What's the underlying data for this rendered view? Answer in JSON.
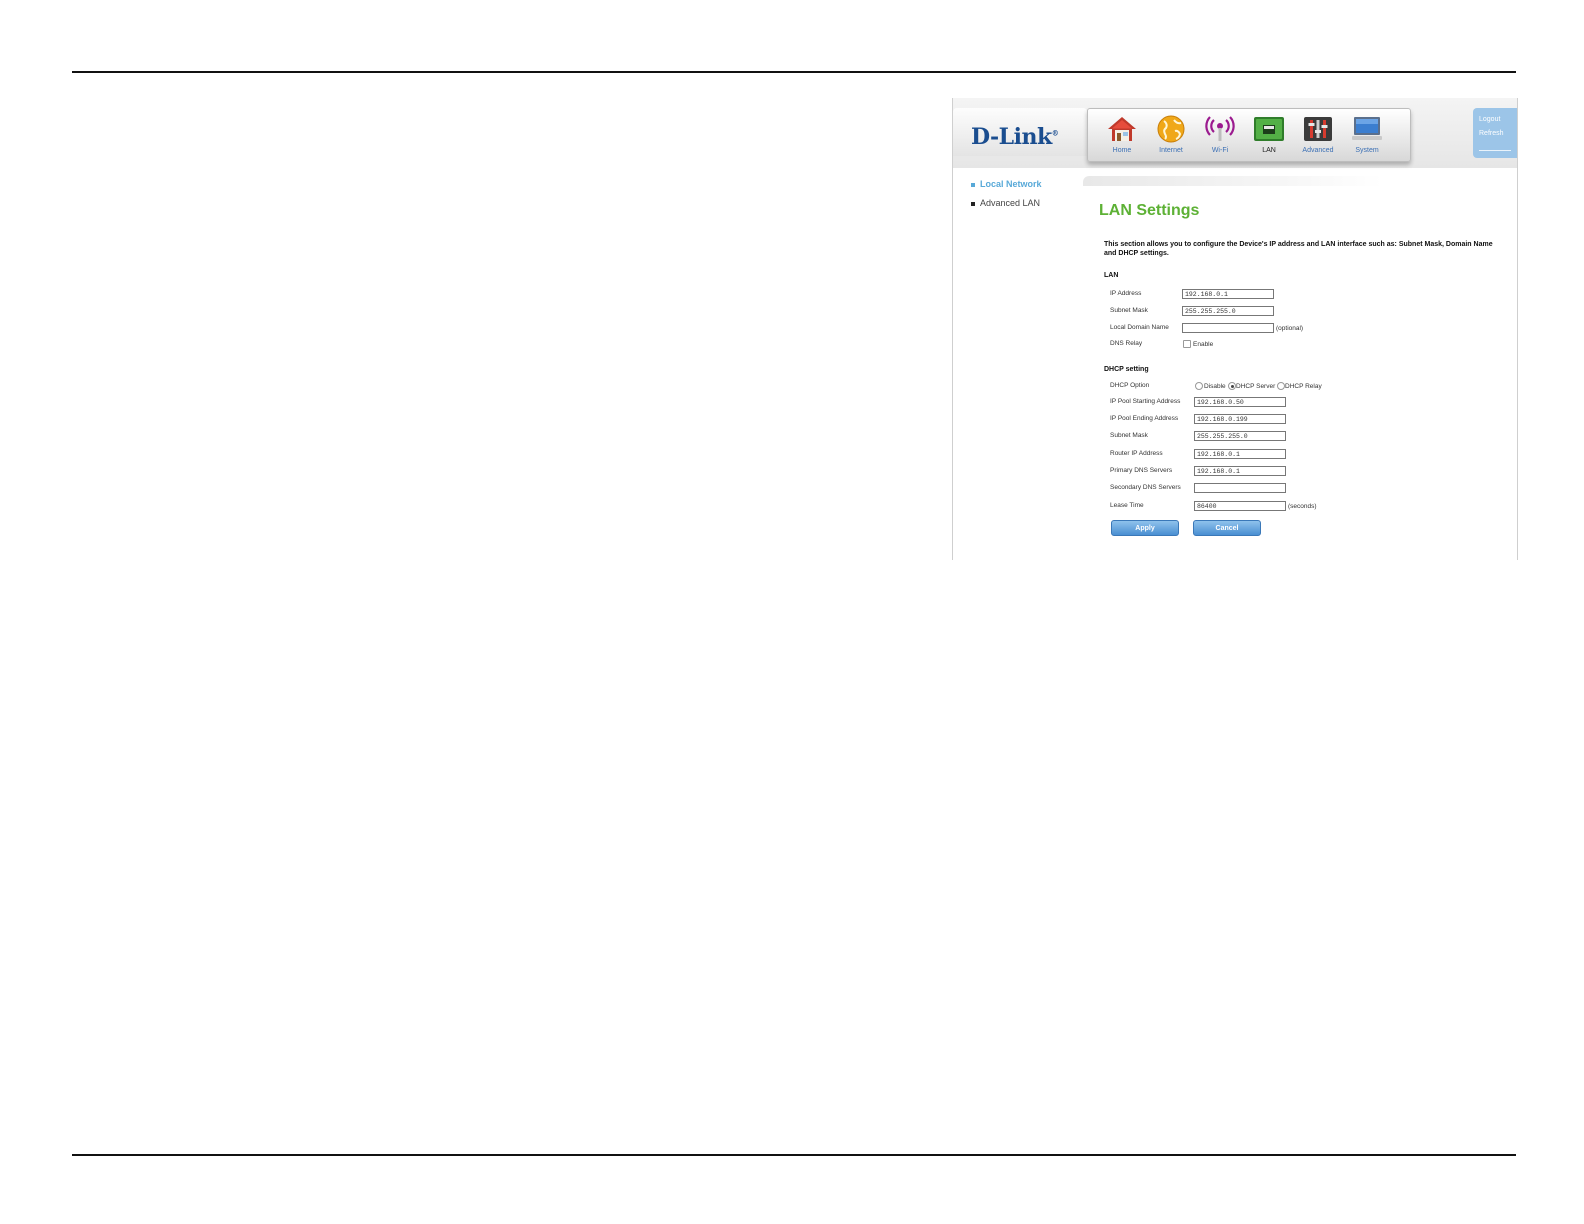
{
  "nav": {
    "items": [
      {
        "label": "Home",
        "icon": "home-icon"
      },
      {
        "label": "Internet",
        "icon": "globe-icon"
      },
      {
        "label": "Wi-Fi",
        "icon": "wifi-icon"
      },
      {
        "label": "LAN",
        "icon": "lan-icon"
      },
      {
        "label": "Advanced",
        "icon": "tools-icon"
      },
      {
        "label": "System",
        "icon": "monitor-icon"
      }
    ],
    "active": "LAN"
  },
  "brand": {
    "logo": "D-Link",
    "mark": "®"
  },
  "top_links": {
    "logout": "Logout",
    "refresh": "Refresh"
  },
  "sidebar": {
    "items": [
      {
        "label": "Local Network"
      },
      {
        "label": "Advanced LAN"
      }
    ]
  },
  "page": {
    "title": "LAN Settings",
    "intro": "This section allows you to configure the Device's IP address and LAN interface such as: Subnet Mask, Domain Name and DHCP settings."
  },
  "lan": {
    "heading": "LAN",
    "ip_label": "IP Address",
    "ip_value": "192.168.0.1",
    "mask_label": "Subnet Mask",
    "mask_value": "255.255.255.0",
    "domain_label": "Local Domain Name",
    "domain_value": "",
    "domain_note": "(optional)",
    "dns_relay_label": "DNS Relay",
    "dns_relay_option": "Enable"
  },
  "dhcp": {
    "heading": "DHCP setting",
    "option_label": "DHCP Option",
    "options": [
      "Disable",
      "DHCP Server",
      "DHCP Relay"
    ],
    "selected": "DHCP Server",
    "pool_start_label": "IP Pool Starting Address",
    "pool_start_value": "192.168.0.50",
    "pool_end_label": "IP Pool Ending Address",
    "pool_end_value": "192.168.0.199",
    "mask_label": "Subnet Mask",
    "mask_value": "255.255.255.0",
    "router_label": "Router IP Address",
    "router_value": "192.168.0.1",
    "primary_dns_label": "Primary DNS Servers",
    "primary_dns_value": "192.168.0.1",
    "secondary_dns_label": "Secondary DNS Servers",
    "secondary_dns_value": "",
    "lease_label": "Lease Time",
    "lease_value": "86400",
    "lease_note": "(seconds)"
  },
  "buttons": {
    "apply": "Apply",
    "cancel": "Cancel"
  },
  "colors": {
    "accent_green": "#5db135",
    "link_blue": "#58a9d8",
    "button_blue": "#4a8fd2",
    "brand_blue": "#1a4d8f"
  }
}
